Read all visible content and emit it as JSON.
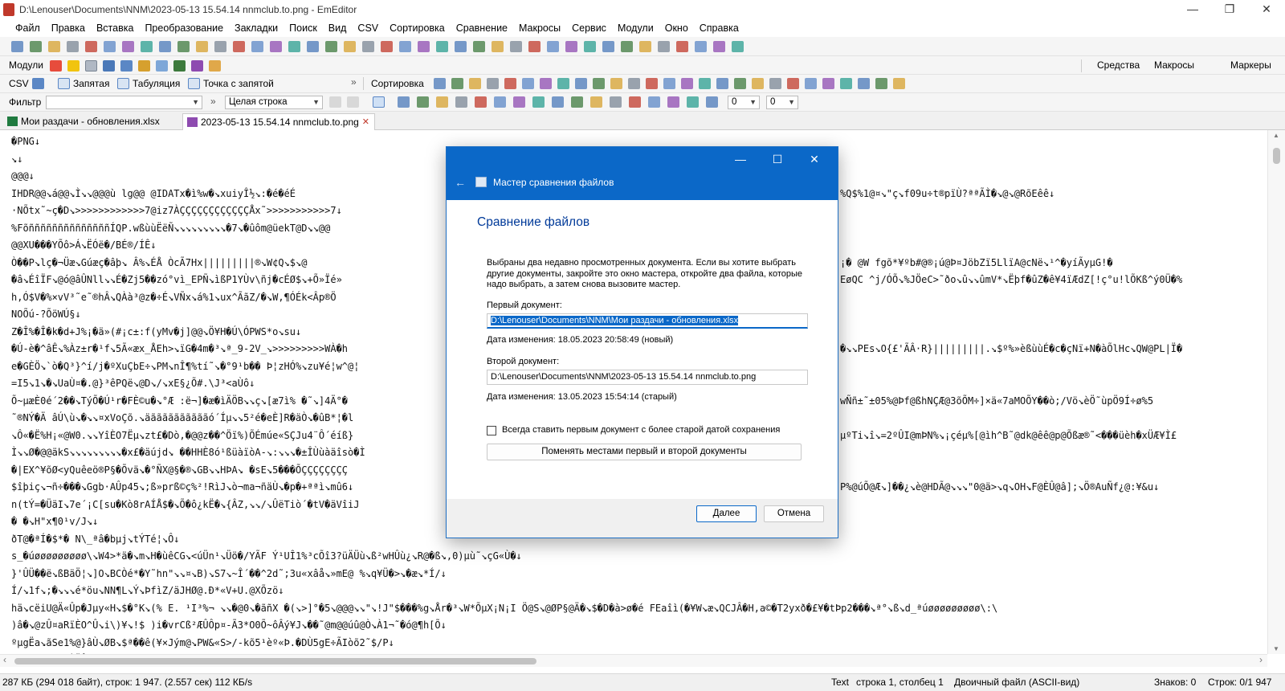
{
  "window": {
    "title": "D:\\Lenouser\\Documents\\NNM\\2023-05-13 15.54.14 nnmclub.to.png - EmEditor",
    "minimize_glyph": "—",
    "maximize_glyph": "❐",
    "close_glyph": "✕"
  },
  "menu": [
    "Файл",
    "Правка",
    "Вставка",
    "Преобразование",
    "Закладки",
    "Поиск",
    "Вид",
    "CSV",
    "Сортировка",
    "Сравнение",
    "Макросы",
    "Сервис",
    "Модули",
    "Окно",
    "Справка"
  ],
  "toolbar_modules": {
    "label": "Модули",
    "right_tabs": [
      "Средства",
      "Макросы",
      "Маркеры"
    ]
  },
  "toolbar_csv": {
    "csv_label": "CSV",
    "items": [
      "Запятая",
      "Табуляция",
      "Точка с запятой"
    ],
    "sort_label": "Сортировка"
  },
  "toolbar_filter": {
    "filter_label": "Фильтр",
    "mode_value": "Целая строка",
    "num1": "0",
    "num2": "0"
  },
  "tabs": [
    {
      "label": "Мои раздачи - обновления.xlsx"
    },
    {
      "label": "2023-05-13 15.54.14 nnmclub.to.png",
      "close": "✕"
    }
  ],
  "editor_lines": [
    "�PNG↓",
    "↘↓",
    "@@@↓",
    "IHDR@@↘á@@↘Ì↘↘@@@ù     lg@@ @IDATx�ì%w�↘xuiyÎ½↘:�é�éÉ",
    "·NÕtx˜~ç�D↘>>>>>>>>>>>>7@iz7ÀÇÇÇÇÇÇÇÇÇÇÇÇÅx˜>>>>>>>>>>>7↓",
    "%FõññññññññññññññÍQP.wßùùËëÑ↘↘↘↘↘↘↘↘↘�7↘�ûôm@üekT@D↘↘@@",
    "@@XU���YÕô>Á↘ËÓë�/BÉ®/ÍÊ↓",
    "Ò��P↘lç�¬Üæ↘Gúæç�âþ↘          Â%↘ÉÅ ÒcÃ7Hx|||||||||®↘W¢Q↘$↘@",
    "�â↘ÉîÏF↘@ó@âÛNll↘↘É�Zj5��zó°vì_EPÑ↘ìßP1YÙv\\ñj�cÉØ$↘+Õ»Ïé»",
    "h,Ó$V�%×vV³˜e˜®hÂ↘QÀà³@z�÷É↘VÑx↘á%1↘ux^ÃãZ/�↘W,¶ÓÉk<Âp®Ö",
    "NOÕú-?ÕöWÚ§↓",
    "Z�Î%�Î�k�d+J%¡�ä»(#¡c±:f(yMv�j]@@↘Ö¥H�Ú\\ÓPWS*o↘su↓",
    "�Ú-è�^âÊ↘%Àz±r�¹f↘5Ã«æx_ÅEh>↘ïG�4m�³↘ª_9-2V_↘>>>>>>>>>WÀ�h",
    "e�GÈÖ↘`ò�Q³}^í/j�ºXuÇbE÷↘PM↘nÎ¶%tí˜↘�°9¹b��    Þ¦zHÓ%↘zu¥é¦w^@¦",
    "=I5↘1↘�↘UaÙ¤�.@}³êPQë↘@D↘/↘xE§¿Õ#.\\J³<aÙô↓",
    "Õ~µæÈ0é´2��↘TýÕ�Ú¹r�FÈ©u�↘°Æ :ë¬]�æ�ìÄÖB↘↘ç↘[æ7ì%  �˜↘]4Ä°�",
    "˜®NÝ�Ä âÚ\\ù↘�↘↘¤xVoÇõ.↘äããããããããããó´Íµ↘↘5²é�eÈ]R�äÒ↘�ûB*¦�l",
    "↘Ô«�Ë%H¡«@W0.↘↘YîÈO7Ëµ↘zt£�Dò,�@@z��^Öï%)ÕÉmúe«SÇJu4¨Ô´éíß}",
    "Ì↘↘Ø�@@äkS↘↘↘↘↘↘↘↘↘�x£�äújd↘  ��HHÈ8ó¹ßüàïòA-↘:↘↘↘�±ÎÙùàäîsò�Ì",
    "�|EX^¥õØ<yQuêeö®P§�Õvä↘�°ÑX@§�®↘GB↘↘HÞA↘  �sE↘5���ÕÇÇÇÇÇÇÇÇ",
    "$îþiç↘¬ñ÷���↘Ggb·AÛp45↘;ß»prß©ç%²!RìJ↘ò¬ma¬ñäÙ↘�p�+ªªì↘mû6↓",
    "n(tÝ=�ÜäI↘7e´¡C[su�Kò8rAÍÅ$�↘Õ�ô¿kË�↘{ÂZ,↘↘/↘ÛëTiò´�tV�äVîiJ",
    "� �↘H\"x¶0¹v/J↘↓",
    "ðT@�ªÍ�$*� N\\_ªâ�bµj↘tÝTé¦↘Ô↓",
    "s_�úøøøøøøøøø\\↘W4>*ä�↘m↘H�ùêCG↘<úÜn¹↘Üö�/YÃF Ý¹UÎ1%³cÕî3?üÄÜù↘ß²wHÛù¿↘R@�ß↘,0)µù˜↘çG«Ù�↓",
    "}'ÛÜ��ë↘ßBäÖ¦↘]O↘BCÒé*�Y˜hn\"↘↘¤↘B)↘S7↘~Î´��^2d˜;3u«xâå↘»mE@ %↘q¥Ü�>↘�æ↘*Í/↓",
    "Í/↘1f↘;�↘↘↘é*öu↘NN¶L↘Ý↘ÞfìZ/äJHØ@.Ð*«V+U.@XÕzö↓",
    "hä↘cëiU@Ä«Ûp�Jµy«H↘$�°K↘(% E. ¹I³%¬ ↘↘�@0↘�ãñX �(↘>]°�5↘@@@↘↘\"↘!J\"$���%g↘År�³↘W*ÕµX¡N¡I Ö@S↘@ØP§@Ä�↘$�D�à>ø�é FEaîì(�¥W↘æ↘QCJÂ�H,a©�T2yxð�£¥�tÞp2���↘ª°↘ß↘d_ªúøøøøøøøøø\\:\\",
    ")â�↘@zÛ¤aRïÈO^Û↘i\\)¥↘!$        )i�vrCß²ÆÛÔp¤-Ã3*O0Õ~ôÂý¥J↘��˜@m@@úû@Ò↘À1¬˜�ó@¶h[Õ↓",
    "ºµgËa↘ãSe1%@}âÙ↘ØB↘$ª��ê(¥×Jým@↘PW&«S>/-kõ5¹èº«Þ.�DÙ5gE÷ÃIòõ2˜$/P↓",
    "@°↘.<ñu¿� ÈÄÛCc¬¦↘¶↓"
  ],
  "right_fragments": [
    {
      "line": 3,
      "text": "%Q$%1@¤↘\"ç↘f09u÷t®pïÙ?ªªÃÌ�↘@↘@RõEêê↓"
    },
    {
      "line": 7,
      "text": "¡�          @W       fgõ*¥ºb#@®¡ú@Þ¤JöbZï5LlïA@cNë↘¹^�yíÃyµG!�"
    },
    {
      "line": 8,
      "text": "EøQC ^j/ÓÕ↘%JÖeC>˜ðo↘û↘↘ûmV*↘Ëþf�ûZ�ê¥4ïÆdZ[!ç°u!lÕKß^ý0Ü�%"
    },
    {
      "line": 12,
      "text": "�↘↘PEs↘O{£'ÃÂ·R}|||||||||.↘$º%»èßùùÉ�c�çNï+N�àÕlHc↘QW@PL|Ï�"
    },
    {
      "line": 15,
      "text": "wÑñ±˜±05%@Þf@ßhNÇÆ@3õÕM÷]×ä«7aMOÕY��ò;/Vö↘èÖ˜ùpÖ9Í÷ø%5"
    },
    {
      "line": 17,
      "text": "µºTi↘î↘=2ºÛI@mÞN%↘¡çéµ%[@ìh^B˜@dk@êê@p@Õßæ®˜<���üèh�xÜÆ¥Ì£"
    },
    {
      "line": 20,
      "text": "P%@úÕ@Æ↘]��¿↘è@HDÃ@↘↘↘\"0@ä>↘q↘OH↘F@ÈÛ@â];↘Ö®AuÑf¿@:¥&u↓"
    }
  ],
  "scrollbars": {
    "up": "▲",
    "down": "▼",
    "left": "‹",
    "right": "›"
  },
  "status": {
    "size": "287 КБ (294 018 байт), строк: 1 947. (2.557 сек) 112 КБ/s",
    "mode": "Text",
    "position": "строка 1, столбец 1",
    "file_type": "Двоичный файл (ASCII-вид)",
    "chars": "Знаков: 0",
    "lines": "Строк: 0/1 947"
  },
  "dialog": {
    "title": "Мастер сравнения файлов",
    "back_glyph": "←",
    "minimize_glyph": "—",
    "maximize_glyph": "☐",
    "close_glyph": "✕",
    "heading": "Сравнение файлов",
    "description": "Выбраны два недавно просмотренных документа. Если вы хотите выбрать другие документы, закройте это окно мастера, откройте два файла, которые надо выбрать, а затем снова вызовите мастер.",
    "first_label": "Первый документ:",
    "first_value": "D:\\Lenouser\\Documents\\NNM\\Мои раздачи - обновления.xlsx",
    "first_date": "Дата изменения: 18.05.2023 20:58:49 (новый)",
    "second_label": "Второй документ:",
    "second_value": "D:\\Lenouser\\Documents\\NNM\\2023-05-13 15.54.14 nnmclub.to.png",
    "second_date": "Дата изменения: 13.05.2023 15:54:14 (старый)",
    "checkbox_label": "Всегда ставить первым документ с более старой датой сохранения",
    "swap_label": "Поменять местами первый и второй документы",
    "next_label": "Далее",
    "cancel_label": "Отмена"
  },
  "colors": {
    "accent": "#0b68c8",
    "heading": "#003a99",
    "toolbar_bg": "#f5f5f5"
  }
}
